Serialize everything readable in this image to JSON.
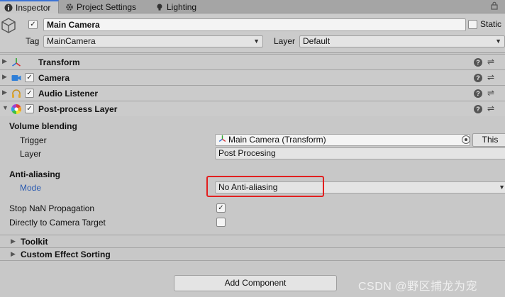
{
  "tabs": [
    {
      "label": "Inspector",
      "icon": "info-icon"
    },
    {
      "label": "Project Settings",
      "icon": "gear-icon"
    },
    {
      "label": "Lighting",
      "icon": "bulb-icon"
    }
  ],
  "header": {
    "object_name": "Main Camera",
    "static_label": "Static",
    "tag_label": "Tag",
    "tag_value": "MainCamera",
    "layer_label": "Layer",
    "layer_value": "Default"
  },
  "components": [
    {
      "name": "Transform",
      "icon": "transform-icon",
      "has_checkbox": false
    },
    {
      "name": "Camera",
      "icon": "camera-icon",
      "has_checkbox": true
    },
    {
      "name": "Audio Listener",
      "icon": "headphones-icon",
      "has_checkbox": true
    },
    {
      "name": "Post-process Layer",
      "icon": "color-wheel-icon",
      "has_checkbox": true
    }
  ],
  "post_process": {
    "volume_blending": {
      "title": "Volume blending",
      "trigger_label": "Trigger",
      "trigger_value": "Main Camera (Transform)",
      "this_button": "This",
      "layer_label": "Layer",
      "layer_value": "Post Procesing"
    },
    "anti_aliasing": {
      "title": "Anti-aliasing",
      "mode_label": "Mode",
      "mode_value": "No Anti-aliasing"
    },
    "stop_nan_label": "Stop NaN Propagation",
    "stop_nan_checked": true,
    "direct_to_camera_label": "Directly to Camera Target",
    "direct_to_camera_checked": false,
    "toolkit_label": "Toolkit",
    "custom_effect_label": "Custom Effect Sorting"
  },
  "footer": {
    "add_component": "Add Component",
    "watermark": "CSDN @野区捕龙为宠"
  },
  "colors": {
    "highlight": "#e21f1f",
    "mode_label": "#2a5ab0",
    "tab_accent": "#3a72d6"
  }
}
